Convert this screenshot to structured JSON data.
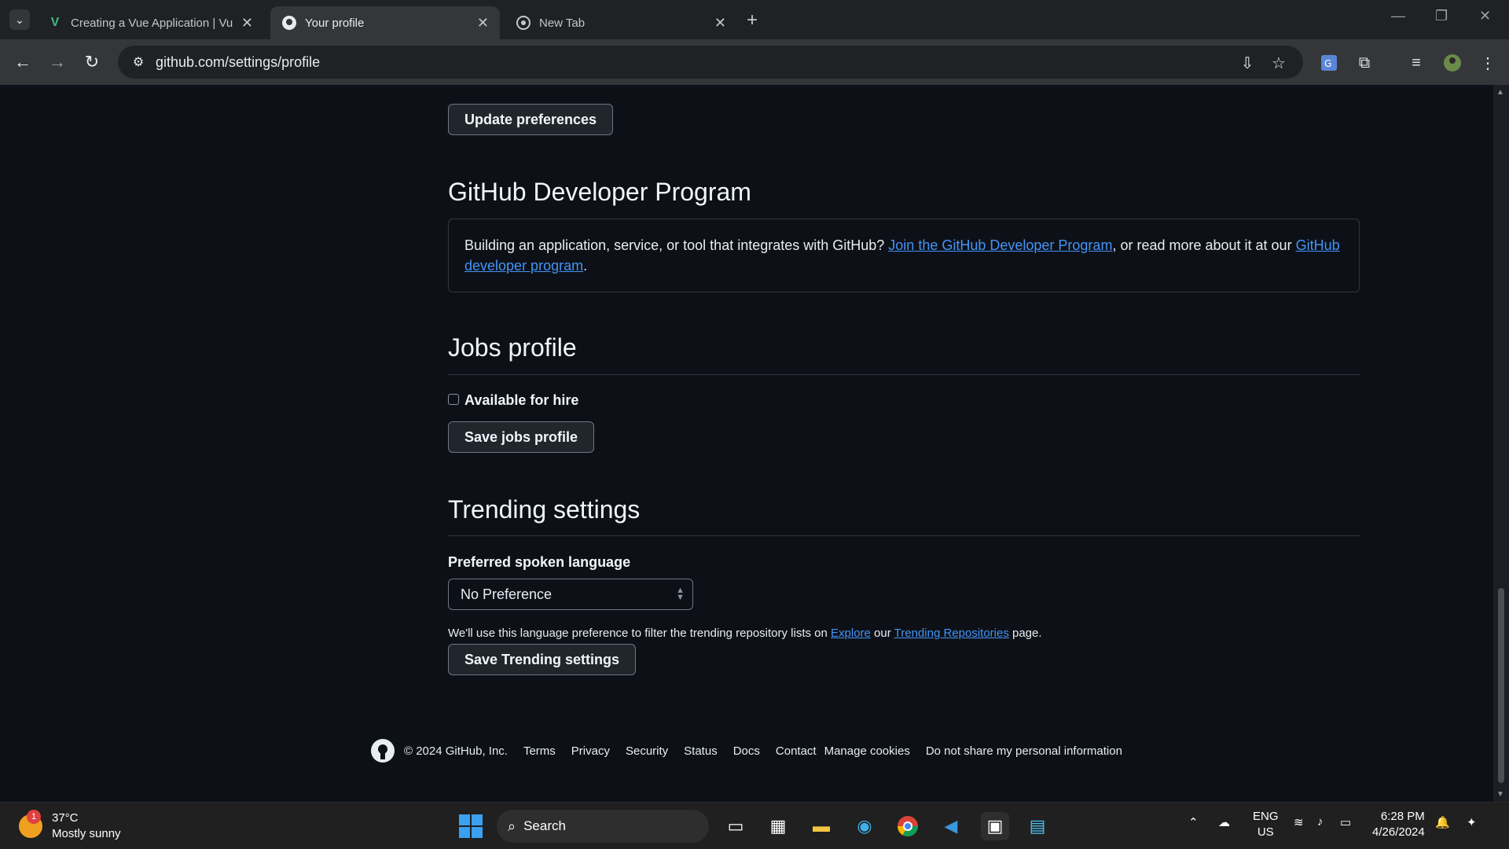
{
  "browser": {
    "tabs": [
      {
        "title": "Creating a Vue Application | Vu",
        "icon": "vue-icon",
        "active": false
      },
      {
        "title": "Your profile",
        "icon": "github-icon",
        "active": true
      },
      {
        "title": "New Tab",
        "icon": "chrome-icon",
        "active": false
      }
    ],
    "url": "github.com/settings/profile"
  },
  "page": {
    "update_preferences_label": "Update preferences",
    "developer_program": {
      "heading": "GitHub Developer Program",
      "text_before": "Building an application, service, or tool that integrates with GitHub? ",
      "link1": "Join the GitHub Developer Program",
      "text_middle": ", or read more about it at our ",
      "link2": "GitHub developer program",
      "text_after": "."
    },
    "jobs": {
      "heading": "Jobs profile",
      "checkbox_label": "Available for hire",
      "save_label": "Save jobs profile"
    },
    "trending": {
      "heading": "Trending settings",
      "language_label": "Preferred spoken language",
      "language_value": "No Preference",
      "note_before": "We'll use this language preference to filter the trending repository lists on ",
      "note_link1": "Explore",
      "note_middle": " our ",
      "note_link2": "Trending Repositories",
      "note_after": " page.",
      "save_label": "Save Trending settings"
    },
    "footer": {
      "copyright": "© 2024 GitHub, Inc.",
      "links": [
        "Terms",
        "Privacy",
        "Security",
        "Status",
        "Docs",
        "Contact",
        "Manage cookies",
        "Do not share my personal information"
      ]
    }
  },
  "taskbar": {
    "weather_temp": "37°C",
    "weather_desc": "Mostly sunny",
    "weather_badge": "1",
    "search_placeholder": "Search",
    "lang_top": "ENG",
    "lang_bottom": "US",
    "time": "6:28 PM",
    "date": "4/26/2024"
  },
  "colors": {
    "page_bg": "#0d1117",
    "link": "#4493f8",
    "button_bg": "#21262d",
    "border": "#30363d"
  }
}
